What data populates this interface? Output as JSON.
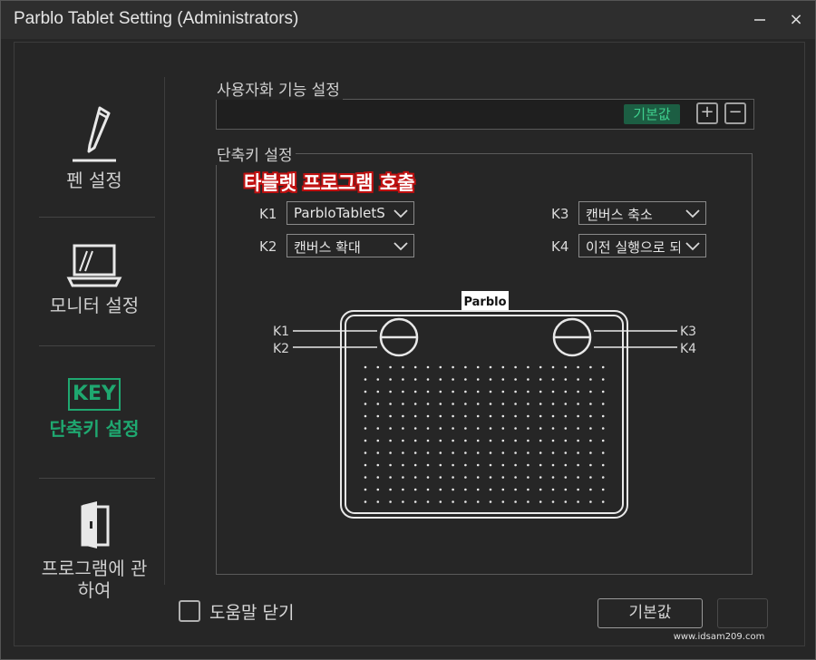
{
  "window": {
    "title": "Parblo Tablet Setting (Administrators)",
    "close_glyph": "×"
  },
  "sidebar": {
    "items": [
      {
        "label": "펜 설정",
        "icon": "pen-icon",
        "active": false
      },
      {
        "label": "모니터 설정",
        "icon": "monitor-icon",
        "active": false
      },
      {
        "label": "단축키 설정",
        "icon": "key-icon",
        "icon_text": "KEY",
        "active": true
      },
      {
        "label_line1": "프로그램에 관",
        "label_line2": "하여",
        "icon": "door-icon",
        "active": false
      }
    ]
  },
  "custom_function": {
    "group_label": "사용자화 기능 설정",
    "default_chip": "기본값",
    "add_glyph": "+",
    "remove_glyph": "−"
  },
  "shortcut": {
    "group_label": "단축키 설정",
    "highlight_title": "타블렛 프로그램 호출",
    "keys": [
      {
        "label": "K1",
        "value": "ParbloTabletS"
      },
      {
        "label": "K2",
        "value": "캔버스 확대"
      },
      {
        "label": "K3",
        "value": "캔버스 축소"
      },
      {
        "label": "K4",
        "value": "이전 실행으로 되"
      }
    ],
    "diagram": {
      "brand": "Parblo",
      "labels": [
        "K1",
        "K2",
        "K3",
        "K4"
      ]
    }
  },
  "footer": {
    "close_help_label": "도움말 닫기",
    "default_button": "기본값",
    "watermark": "www.idsam209.com"
  },
  "colors": {
    "accent": "#1fa870",
    "highlight_outline": "#c01010"
  }
}
